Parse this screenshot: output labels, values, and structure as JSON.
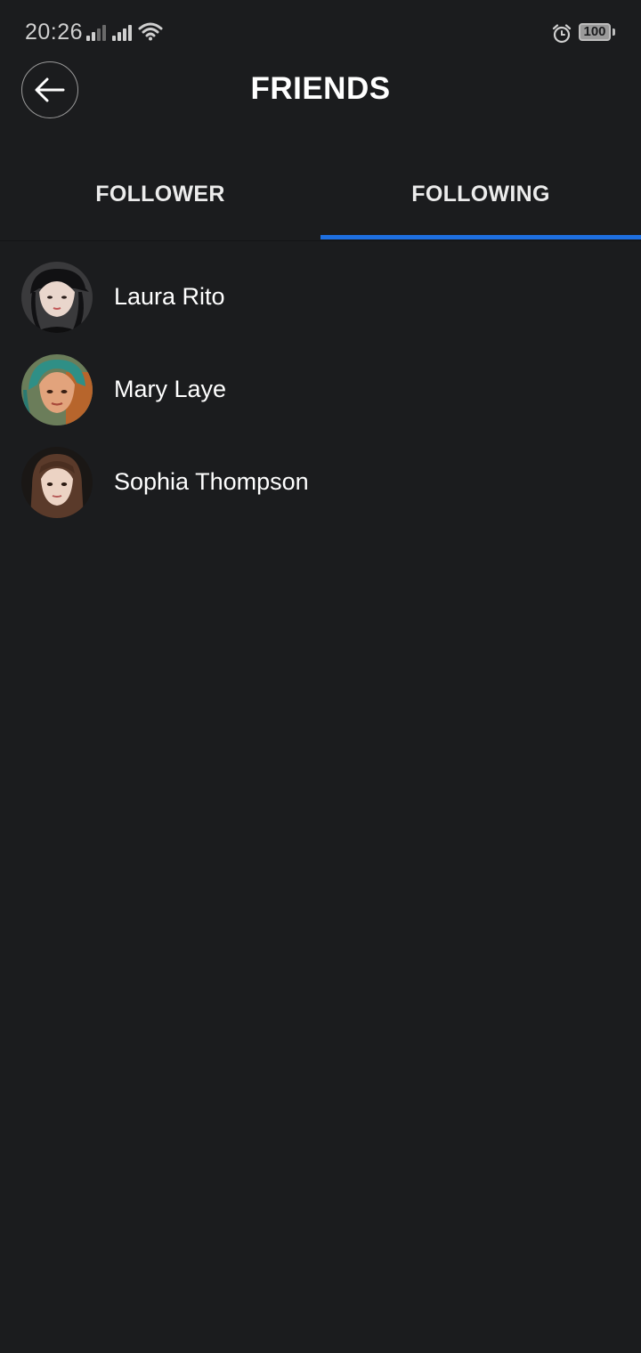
{
  "status_bar": {
    "time": "20:26",
    "battery": "100",
    "icons": [
      "signal-1-icon",
      "signal-2-icon",
      "wifi-icon",
      "alarm-icon",
      "battery-icon"
    ]
  },
  "header": {
    "back_icon": "arrow-left-icon",
    "title": "FRIENDS"
  },
  "tabs": [
    {
      "label": "FOLLOWER",
      "active": false
    },
    {
      "label": "FOLLOWING",
      "active": true
    }
  ],
  "colors": {
    "background": "#1b1c1e",
    "accent": "#1e6fe0",
    "text": "#ffffff"
  },
  "friends": [
    {
      "name": "Laura Rito"
    },
    {
      "name": "Mary Laye"
    },
    {
      "name": "Sophia Thompson"
    }
  ]
}
